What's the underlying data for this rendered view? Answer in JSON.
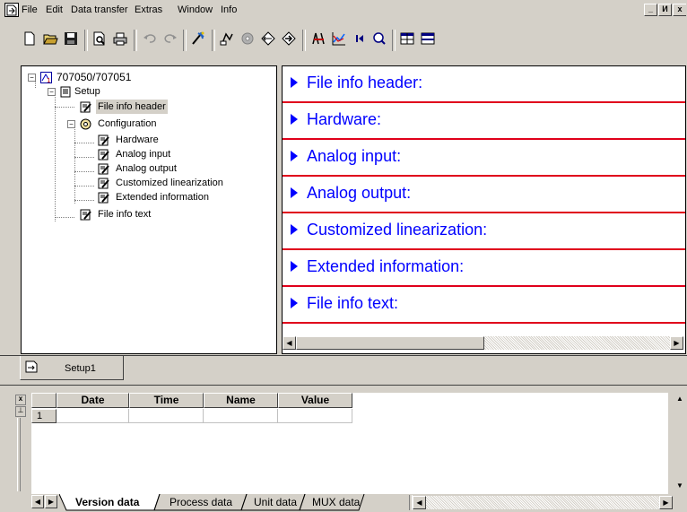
{
  "menu": {
    "items": [
      "File",
      "Edit",
      "Data transfer",
      "Extras",
      "Window",
      "Info"
    ],
    "window_controls": [
      "_",
      "И",
      "x"
    ]
  },
  "toolbar": {
    "buttons": [
      "new-doc",
      "open-folder",
      "save",
      "print-preview",
      "print",
      "undo",
      "redo",
      "wizard",
      "transfer",
      "disk",
      "connect",
      "download",
      "measure",
      "chart",
      "first-record",
      "search",
      "table",
      "columns"
    ]
  },
  "tree": {
    "root": "707050/707051",
    "setup": "Setup",
    "file_info_header": "File info header",
    "configuration": "Configuration",
    "hardware": "Hardware",
    "analog_input": "Analog input",
    "analog_output": "Analog output",
    "customized_linearization": "Customized linearization",
    "extended_information": "Extended information",
    "file_info_text": "File info text"
  },
  "sections": [
    "File info header:",
    "Hardware:",
    "Analog input:",
    "Analog output:",
    "Customized linearization:",
    "Extended information:",
    "File info text:"
  ],
  "document_tab": {
    "label": "Setup1"
  },
  "grid": {
    "columns": [
      "Date",
      "Time",
      "Name",
      "Value"
    ],
    "row_number": "1"
  },
  "bottom_tabs": [
    "Version data",
    "Process data",
    "Unit data",
    "MUX data"
  ],
  "colors": {
    "section_text": "#0000ff",
    "section_divider": "#e0001b",
    "chrome": "#d4d0c8"
  }
}
